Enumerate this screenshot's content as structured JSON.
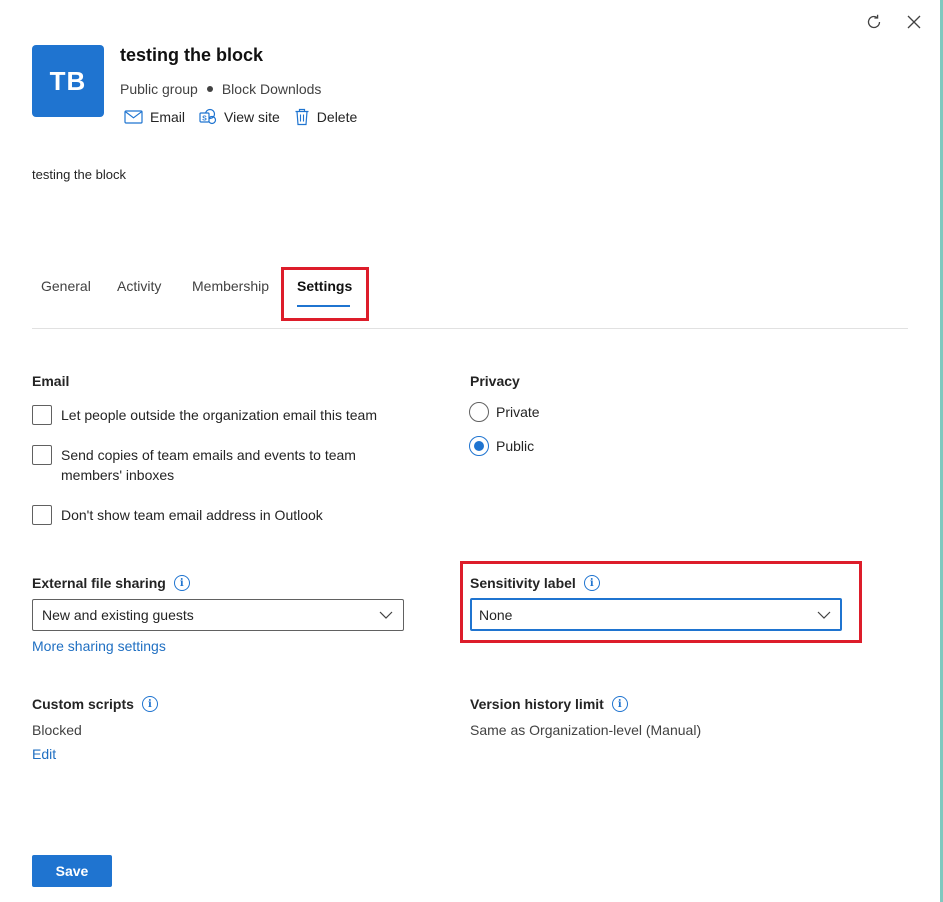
{
  "group": {
    "initials": "TB",
    "title": "testing the block",
    "visibility": "Public group",
    "label": "Block Downlods",
    "description": "testing the block"
  },
  "actions": {
    "email": "Email",
    "view_site": "View site",
    "delete": "Delete"
  },
  "tabs": [
    {
      "label": "General"
    },
    {
      "label": "Activity"
    },
    {
      "label": "Membership"
    },
    {
      "label": "Settings",
      "active": true
    }
  ],
  "email_section": {
    "label": "Email",
    "options": [
      {
        "label": "Let people outside the organization email this team",
        "checked": false
      },
      {
        "label": "Send copies of team emails and events to team members' inboxes",
        "checked": false
      },
      {
        "label": "Don't show team email address in Outlook",
        "checked": false
      }
    ]
  },
  "privacy": {
    "label": "Privacy",
    "options": [
      {
        "label": "Private",
        "selected": false
      },
      {
        "label": "Public",
        "selected": true
      }
    ]
  },
  "external_sharing": {
    "label": "External file sharing",
    "value": "New and existing guests",
    "link": "More sharing settings"
  },
  "sensitivity": {
    "label": "Sensitivity label",
    "value": "None"
  },
  "custom_scripts": {
    "label": "Custom scripts",
    "value": "Blocked",
    "edit": "Edit"
  },
  "version_history": {
    "label": "Version history limit",
    "value": "Same as Organization-level (Manual)"
  },
  "save_label": "Save",
  "colors": {
    "accent": "#1f74d0",
    "highlight": "#dd1d2a"
  }
}
